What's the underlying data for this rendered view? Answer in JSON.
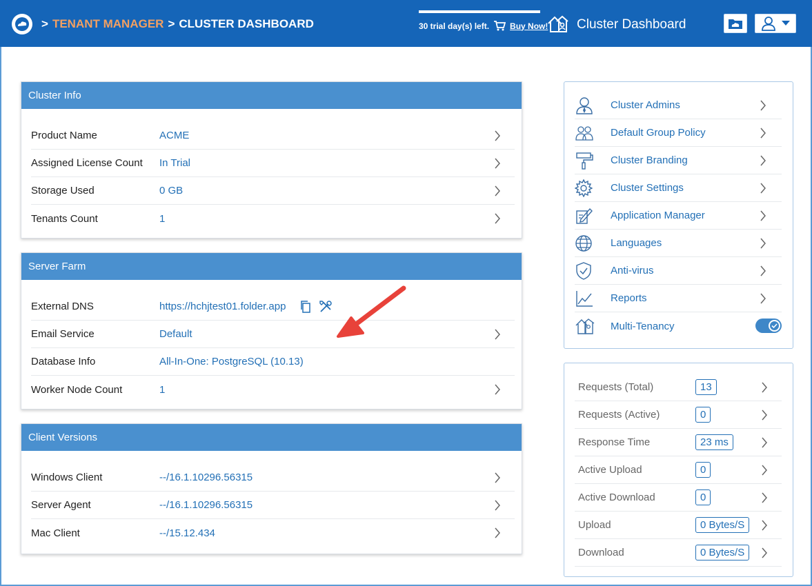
{
  "header": {
    "crumb_sep_1": ">",
    "crumb_tenant": "TENANT MANAGER",
    "crumb_sep_2": ">",
    "crumb_current": "CLUSTER DASHBOARD",
    "trial_text": "30 trial day(s) left.",
    "buy_now": "Buy Now!",
    "title": "Cluster Dashboard"
  },
  "cluster_info": {
    "title": "Cluster Info",
    "rows": [
      {
        "label": "Product Name",
        "value": "ACME"
      },
      {
        "label": "Assigned License Count",
        "value": "In Trial"
      },
      {
        "label": "Storage Used",
        "value": "0 GB"
      },
      {
        "label": "Tenants Count",
        "value": "1"
      }
    ]
  },
  "server_farm": {
    "title": "Server Farm",
    "rows": [
      {
        "label": "External DNS",
        "value": "https://hchjtest01.folder.app"
      },
      {
        "label": "Email Service",
        "value": "Default"
      },
      {
        "label": "Database Info",
        "value": "All-In-One: PostgreSQL (10.13)"
      },
      {
        "label": "Worker Node Count",
        "value": "1"
      }
    ]
  },
  "client_versions": {
    "title": "Client Versions",
    "rows": [
      {
        "label": "Windows Client",
        "value": "--/16.1.10296.56315"
      },
      {
        "label": "Server Agent",
        "value": "--/16.1.10296.56315"
      },
      {
        "label": "Mac Client",
        "value": "--/15.12.434"
      }
    ]
  },
  "menu": {
    "items": [
      {
        "label": "Cluster Admins",
        "icon": "admin-user-icon"
      },
      {
        "label": "Default Group Policy",
        "icon": "group-icon"
      },
      {
        "label": "Cluster Branding",
        "icon": "paint-roller-icon"
      },
      {
        "label": "Cluster Settings",
        "icon": "gear-icon"
      },
      {
        "label": "Application Manager",
        "icon": "app-edit-icon"
      },
      {
        "label": "Languages",
        "icon": "globe-icon"
      },
      {
        "label": "Anti-virus",
        "icon": "shield-check-icon"
      },
      {
        "label": "Reports",
        "icon": "chart-line-icon"
      },
      {
        "label": "Multi-Tenancy",
        "icon": "multi-house-icon",
        "toggle_on": true
      }
    ]
  },
  "stats": {
    "rows": [
      {
        "label": "Requests (Total)",
        "value": "13"
      },
      {
        "label": "Requests (Active)",
        "value": "0"
      },
      {
        "label": "Response Time",
        "value": "23 ms"
      },
      {
        "label": "Active Upload",
        "value": "0"
      },
      {
        "label": "Active Download",
        "value": "0"
      },
      {
        "label": "Upload",
        "value": "0 Bytes/S"
      },
      {
        "label": "Download",
        "value": "0 Bytes/S"
      }
    ]
  },
  "colors": {
    "header_bg": "#1565b8",
    "card_header": "#4a90cf",
    "link_blue": "#2370b6",
    "breadcrumb_orange": "#f2a062",
    "annotation_arrow": "#e8423a"
  }
}
